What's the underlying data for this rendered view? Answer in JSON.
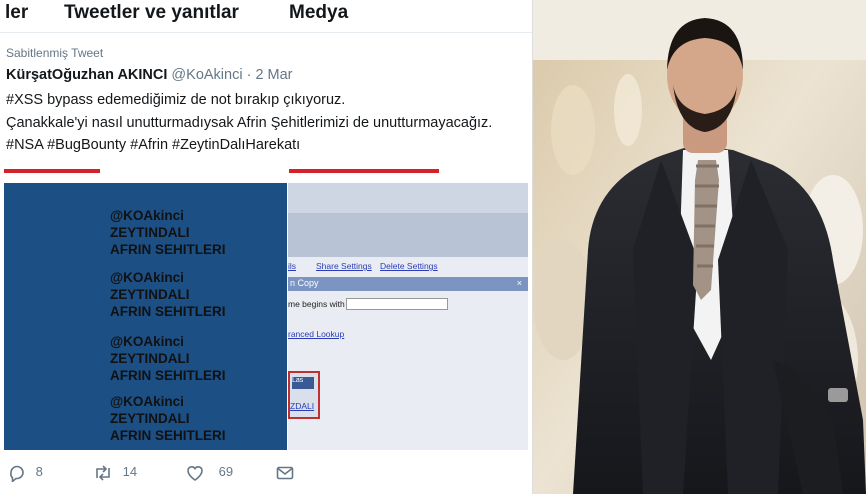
{
  "tabs": [
    "ler",
    "Tweetler ve yanıtlar",
    "Medya"
  ],
  "tweet": {
    "pinned_label": "Sabitlenmiş Tweet",
    "author_name": "KürşatOğuzhan AKINCI",
    "author_handle": "@KoAkinci",
    "date": "· 2 Mar",
    "lines": [
      "#XSS bypass edemediğimiz de not bırakıp çıkıyoruz.",
      "Çanakkale'yi nasıl unutturmadıysak Afrin Şehitlerimizi de unutturmayacağız.",
      "#NSA #BugBounty #Afrin #ZeytinDalıHarekatı"
    ]
  },
  "media": {
    "blocks": [
      [
        "@KOAkinci",
        "ZEYTINDALI",
        "AFRIN SEHITLERI"
      ],
      [
        "@KOAkinci",
        "ZEYTINDALI",
        "AFRIN SEHITLERI"
      ],
      [
        "@KOAkinci",
        "ZEYTINDALI",
        "AFRIN SEHITLERI"
      ],
      [
        "@KOAkinci",
        "ZEYTINDALI",
        "AFRIN SEHITLERI"
      ]
    ],
    "links": [
      "ils",
      "Share Settings",
      "Delete Settings"
    ],
    "dialog_title": "n Copy",
    "dialog_close": "×",
    "field_label": "me begins with",
    "lookup_link": "ranced Lookup",
    "box_top": "Las",
    "box_link": "ZDALI"
  },
  "actions": {
    "reply_count": "8",
    "retweet_count": "14",
    "like_count": "69"
  },
  "colors": {
    "accent_red": "#d6202a",
    "panel_blue": "#1c4f84",
    "grey_text": "#657786"
  }
}
